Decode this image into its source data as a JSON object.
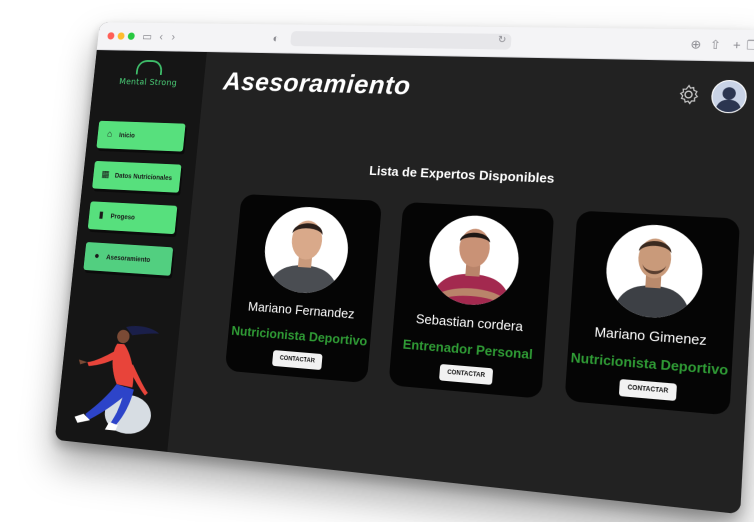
{
  "app": {
    "logo_text": "Mental Strong"
  },
  "sidebar": {
    "items": [
      {
        "label": "Inicio",
        "icon": "home-icon"
      },
      {
        "label": "Datos Nutricionales",
        "icon": "calculator-icon"
      },
      {
        "label": "Progeso",
        "icon": "bar-chart-icon"
      },
      {
        "label": "Asesoramiento",
        "icon": "apple-icon"
      }
    ]
  },
  "header": {
    "title": "Asesoramiento"
  },
  "main": {
    "section_title": "Lista de Expertos Disponibles",
    "experts": [
      {
        "name": "Mariano Fernandez",
        "role": "Nutricionista Deportivo",
        "button": "CONTACTAR",
        "shirt_color": "#4a4d52"
      },
      {
        "name": "Sebastian cordera",
        "role": "Entrenador Personal",
        "button": "CONTACTAR",
        "shirt_color": "#a3294f"
      },
      {
        "name": "Mariano Gimenez",
        "role": "Nutricionista Deportivo",
        "button": "CONTACTAR",
        "shirt_color": "#3d4045"
      }
    ]
  },
  "colors": {
    "accent_green": "#57e07d",
    "role_green": "#2f9b35",
    "background": "#222222",
    "sidebar_bg": "#151515"
  }
}
